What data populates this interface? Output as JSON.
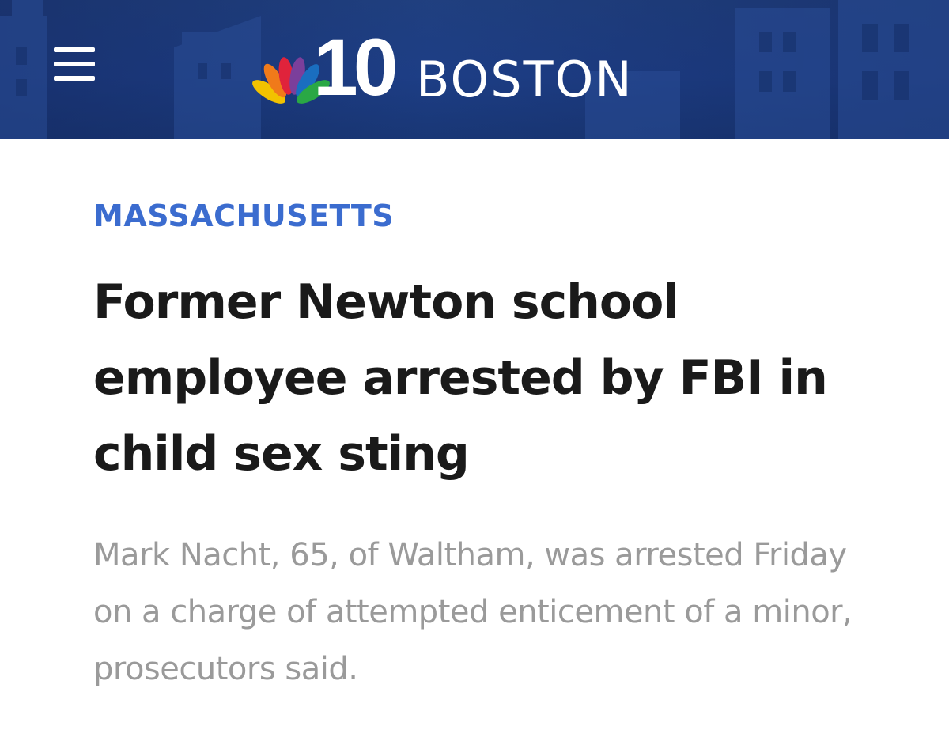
{
  "header": {
    "menu_icon": "hamburger-menu-icon",
    "logo": {
      "peacock_icon": "nbc-peacock-icon",
      "number": "10",
      "city": "BOSTON"
    },
    "background_color": "#1d3e86"
  },
  "article": {
    "category": "MASSACHUSETTS",
    "category_color": "#3b6ccf",
    "headline": "Former Newton school employee arrested by FBI in child sex sting",
    "summary": "Mark Nacht, 65, of Waltham, was arrested Friday on a charge of attempted enticement of a minor, prosecutors said."
  }
}
